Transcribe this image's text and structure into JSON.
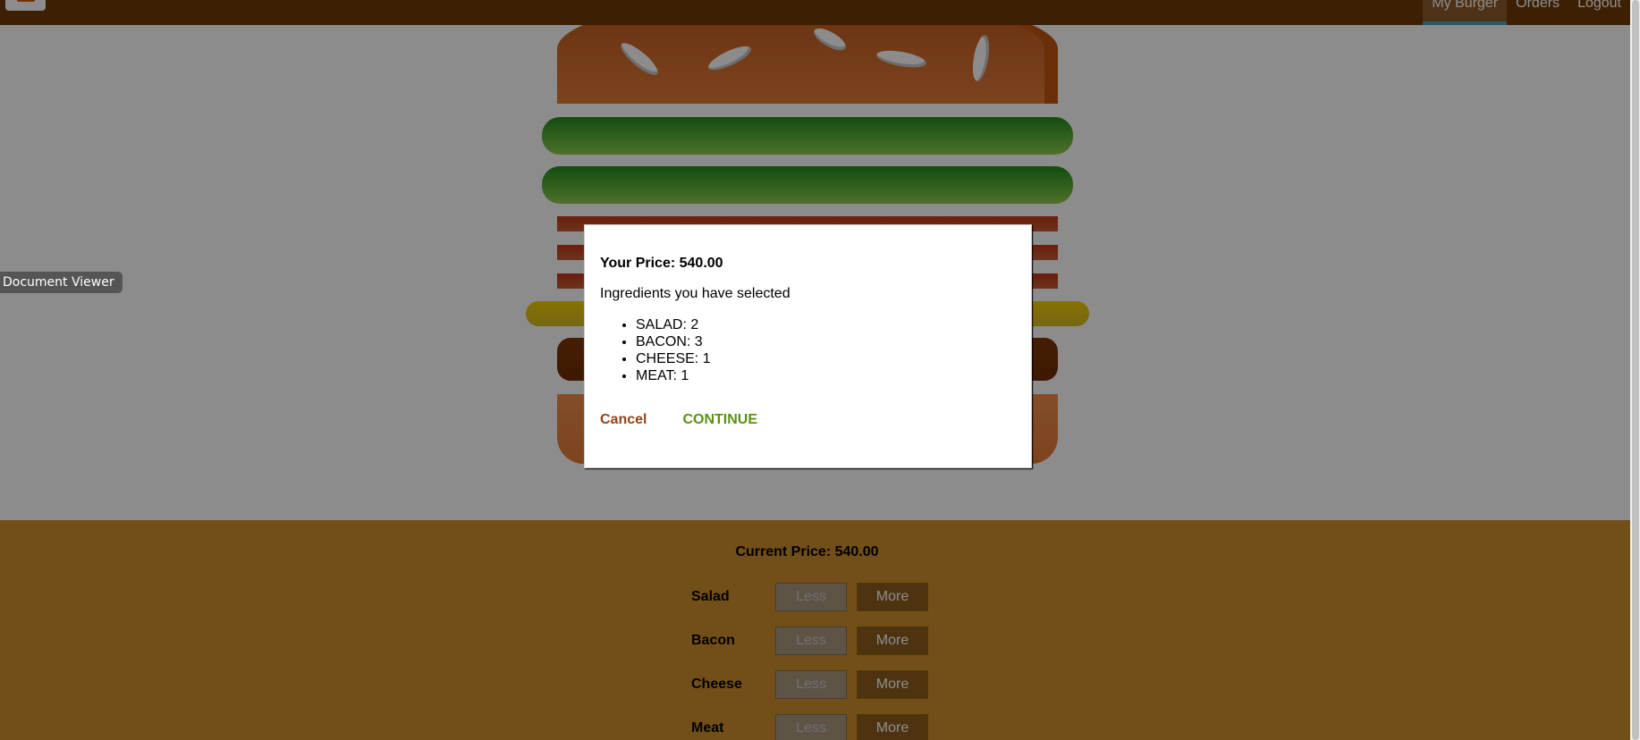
{
  "nav": {
    "items": [
      {
        "label": "My Burger",
        "active": true
      },
      {
        "label": "Orders",
        "active": false
      },
      {
        "label": "Logout",
        "active": false
      }
    ]
  },
  "tooltip": {
    "label": "Document Viewer"
  },
  "modal": {
    "price_label": "Your Price: 540.00",
    "subtitle": "Ingredients you have selected",
    "ingredients": [
      "SALAD: 2",
      "BACON: 3",
      "CHEESE: 1",
      "MEAT: 1"
    ],
    "cancel_label": "Cancel",
    "continue_label": "CONTINUE"
  },
  "build_controls": {
    "current_price_label": "Current Price: 540.00",
    "rows": [
      {
        "label": "Salad",
        "less": "Less",
        "more": "More"
      },
      {
        "label": "Bacon",
        "less": "Less",
        "more": "More"
      },
      {
        "label": "Cheese",
        "less": "Less",
        "more": "More"
      },
      {
        "label": "Meat",
        "less": "Less",
        "more": "More"
      }
    ]
  },
  "colors": {
    "toolbar": "#703B09",
    "controls_bg": "#CF8F2E",
    "cancel": "#944317",
    "continue": "#5C9210",
    "nav_active_underline": "#40A4C8"
  }
}
